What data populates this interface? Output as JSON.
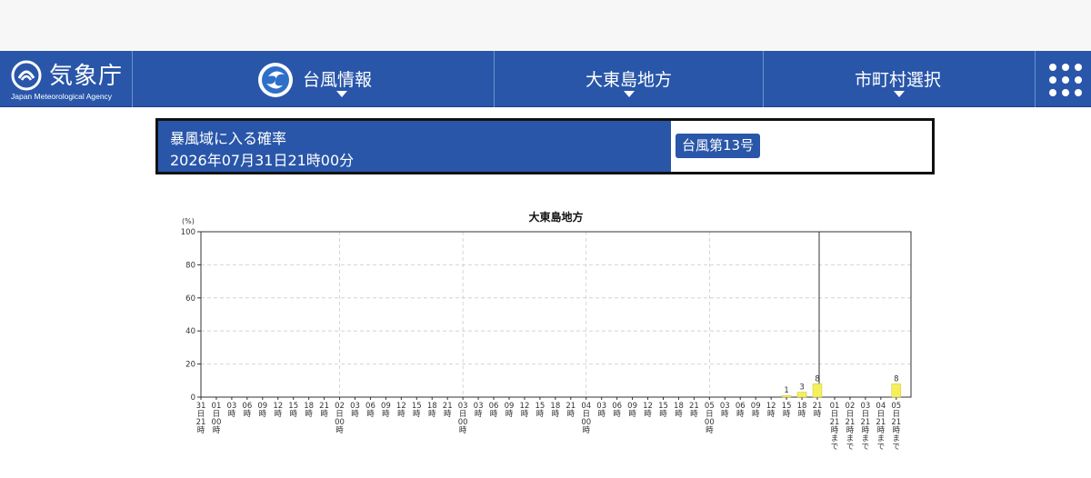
{
  "header": {
    "agency_name": "気象庁",
    "agency_english": "Japan Meteorological Agency",
    "nav": [
      {
        "label": "台風情報",
        "icon": "typhoon-icon"
      },
      {
        "label": "大東島地方"
      },
      {
        "label": "市町村選択"
      }
    ],
    "menu_icon": "grid-menu-icon"
  },
  "info": {
    "title": "暴風域に入る確率",
    "datetime": "2026年07月31日21時00分",
    "typhoon_badge": "台風第13号"
  },
  "colors": {
    "nav_blue": "#2956a9",
    "bar_yellow": "#f5ef5c"
  },
  "chart_data": {
    "type": "bar",
    "title": "大東島地方",
    "ylabel": "(%)",
    "ylim": [
      0,
      100
    ],
    "yticks": [
      0,
      20,
      40,
      60,
      80,
      100
    ],
    "grid": true,
    "categories": [
      "31日21時",
      "01日00時",
      "03時",
      "06時",
      "09時",
      "12時",
      "15時",
      "18時",
      "21時",
      "02日00時",
      "03時",
      "06時",
      "09時",
      "12時",
      "15時",
      "18時",
      "21時",
      "03日00時",
      "03時",
      "06時",
      "09時",
      "12時",
      "15時",
      "18時",
      "21時",
      "04日00時",
      "03時",
      "06時",
      "09時",
      "12時",
      "15時",
      "18時",
      "21時",
      "05日00時",
      "03時",
      "06時",
      "09時",
      "12時",
      "15時",
      "18時",
      "21時"
    ],
    "values": [
      0,
      0,
      0,
      0,
      0,
      0,
      0,
      0,
      0,
      0,
      0,
      0,
      0,
      0,
      0,
      0,
      0,
      0,
      0,
      0,
      0,
      0,
      0,
      0,
      0,
      0,
      0,
      0,
      0,
      0,
      0,
      0,
      0,
      0,
      0,
      0,
      0,
      0,
      1,
      3,
      8
    ],
    "cumulative_categories": [
      "01日21時まで",
      "02日21時まで",
      "03日21時まで",
      "04日21時まで",
      "05日21時まで"
    ],
    "cumulative_values": [
      0,
      0,
      0,
      0,
      8
    ],
    "day_boundaries": [
      "01日00時",
      "02日00時",
      "03日00時",
      "04日00時",
      "05日00時"
    ]
  }
}
